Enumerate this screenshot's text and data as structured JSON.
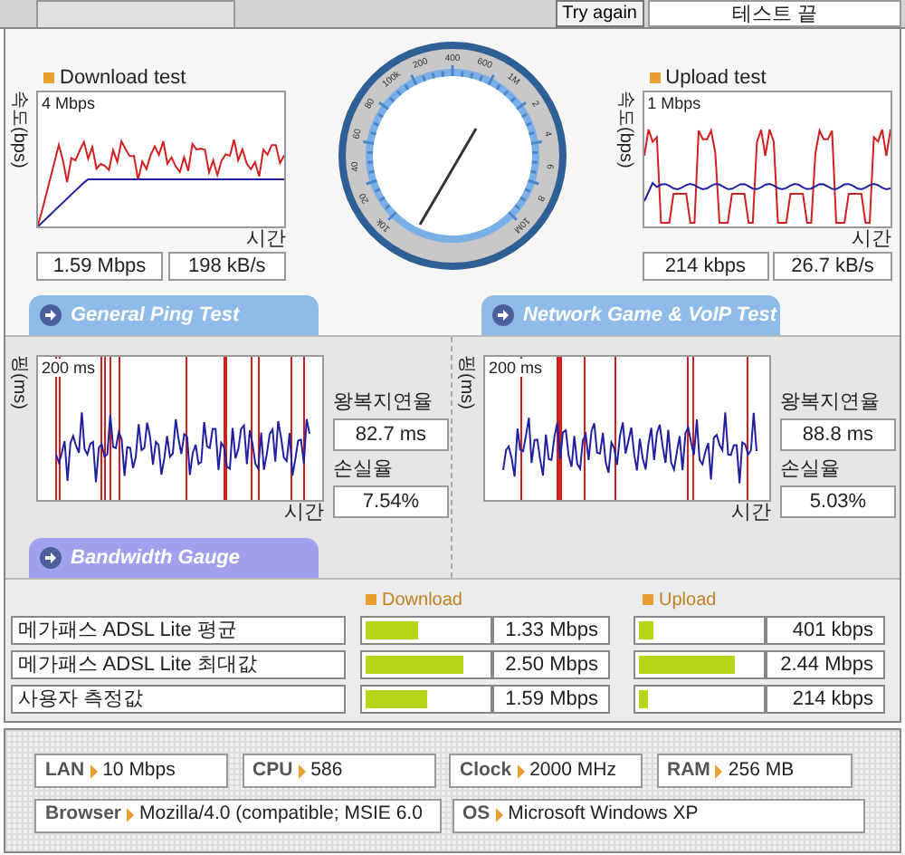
{
  "top_bar": {
    "retry_button": "Try again",
    "status": "테스트 끝"
  },
  "download_test": {
    "title": "Download test",
    "y_axis": "속도(bps)",
    "max_label": "4 Mbps",
    "x_axis": "시간",
    "speed": "1.59 Mbps",
    "rate": "198 kB/s"
  },
  "gauge": {
    "labels": [
      "10k",
      "20",
      "40",
      "60",
      "80",
      "100k",
      "200",
      "400",
      "600",
      "1M",
      "2",
      "4",
      "6",
      "8",
      "10M"
    ]
  },
  "upload_test": {
    "title": "Upload test",
    "y_axis": "속도(bps)",
    "max_label": "1 Mbps",
    "x_axis": "시간",
    "speed": "214 kbps",
    "rate": "26.7 kB/s"
  },
  "section_tabs": [
    "General Ping Test",
    "Network Game & VoIP Test"
  ],
  "ping_tests": [
    {
      "y_axis": "핑(ms)",
      "max_label": "200 ms",
      "x_axis": "시간",
      "latency_label": "왕복지연율",
      "latency": "82.7 ms",
      "loss_label": "손실율",
      "loss": "7.54%"
    },
    {
      "y_axis": "핑(ms)",
      "max_label": "200 ms",
      "x_axis": "시간",
      "latency_label": "왕복지연율",
      "latency": "88.8 ms",
      "loss_label": "손실율",
      "loss": "5.03%"
    }
  ],
  "bandwidth": {
    "title": "Bandwidth Gauge",
    "download_header": "Download",
    "upload_header": "Upload",
    "rows": [
      {
        "name": "메가패스 ADSL Lite 평균",
        "download": {
          "level": 0.44,
          "value": "1.33 Mbps"
        },
        "upload": {
          "level": 0.12,
          "value": "401 kbps"
        }
      },
      {
        "name": "메가패스 ADSL Lite 최대값",
        "download": {
          "level": 0.81,
          "value": "2.50 Mbps"
        },
        "upload": {
          "level": 0.79,
          "value": "2.44 Mbps"
        }
      },
      {
        "name": "사용자 측정값",
        "download": {
          "level": 0.51,
          "value": "1.59 Mbps"
        },
        "upload": {
          "level": 0.07,
          "value": "214 kbps"
        }
      }
    ]
  },
  "system_info": [
    {
      "label": "LAN",
      "value": "10 Mbps"
    },
    {
      "label": "CPU",
      "value": "586"
    },
    {
      "label": "Clock",
      "value": "2000 MHz"
    },
    {
      "label": "RAM",
      "value": "256 MB"
    },
    {
      "label": "Browser",
      "value": "Mozilla/4.0 (compatible; MSIE 6.0"
    },
    {
      "label": "OS",
      "value": "Microsoft Windows XP"
    }
  ]
}
